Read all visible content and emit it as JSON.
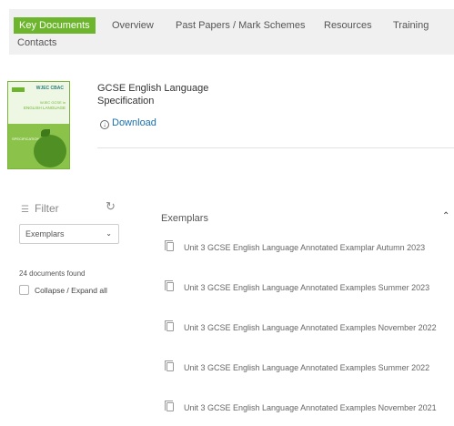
{
  "tabs": [
    {
      "label": "Key Documents",
      "active": true
    },
    {
      "label": "Overview",
      "active": false
    },
    {
      "label": "Past Papers / Mark Schemes",
      "active": false
    },
    {
      "label": "Resources",
      "active": false
    },
    {
      "label": "Training",
      "active": false
    },
    {
      "label": "Contacts",
      "active": false
    }
  ],
  "document": {
    "title": "GCSE English Language Specification",
    "download_label": "Download",
    "thumbnail": {
      "badge": "GCSE",
      "logo": "WJEC CBAC",
      "line1": "WJEC GCSE in",
      "line2": "ENGLISH LANGUAGE",
      "line3": "SPECIFICATION"
    }
  },
  "filter": {
    "label": "Filter",
    "selected": "Exemplars",
    "found_text": "24 documents found",
    "collapse_label": "Collapse / Expand all"
  },
  "results": {
    "section_title": "Exemplars",
    "items": [
      {
        "title": "Unit 3 GCSE English Language Annotated Examplar Autumn 2023"
      },
      {
        "title": "Unit 3 GCSE English Language Annotated Examples Summer 2023"
      },
      {
        "title": "Unit 3 GCSE English Language Annotated Examples November 2022"
      },
      {
        "title": "Unit 3 GCSE English Language Annotated Examples Summer 2022"
      },
      {
        "title": "Unit 3 GCSE English Language Annotated Examples November 2021"
      }
    ]
  },
  "colors": {
    "accent": "#6cb52d",
    "link": "#1a6fa8",
    "tabbar_bg": "#f0f0f0"
  }
}
